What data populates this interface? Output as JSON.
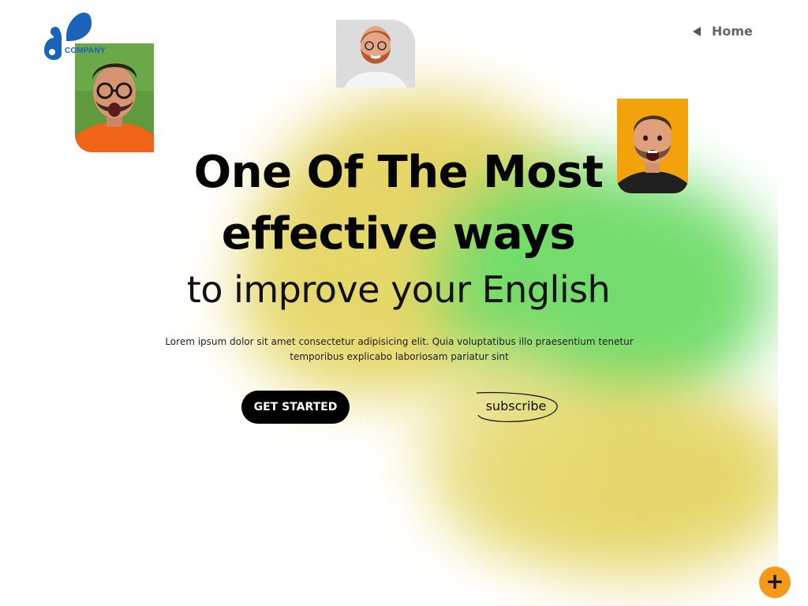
{
  "brand": {
    "logo_text": "COMPANY",
    "logo_color": "#1a63b8"
  },
  "nav": {
    "home_label": "Home",
    "home_icon": "triangle-left-icon"
  },
  "hero": {
    "title_line1": "One Of The Most",
    "title_line2": "effective ways",
    "subtitle": "to improve your English",
    "description_line1": "Lorem ipsum dolor sit amet consectetur adipisicing elit. Quia voluptatibus illo praesentium tenetur",
    "description_line2": "temporibus explicabo laboriosam pariatur sint"
  },
  "actions": {
    "get_started_label": "GET STARTED",
    "subscribe_label": "subscribe"
  },
  "fab": {
    "icon": "plus-icon",
    "label": "+",
    "color": "#f39a1b"
  },
  "colors": {
    "blob_yellow": "#e3d25c",
    "blob_green": "#6fdc6a",
    "photo1_bg": "#5f9a3f",
    "photo1_shirt": "#f06418",
    "photo2_bg": "#d9d9d9",
    "photo3_bg": "#f2a20a"
  }
}
